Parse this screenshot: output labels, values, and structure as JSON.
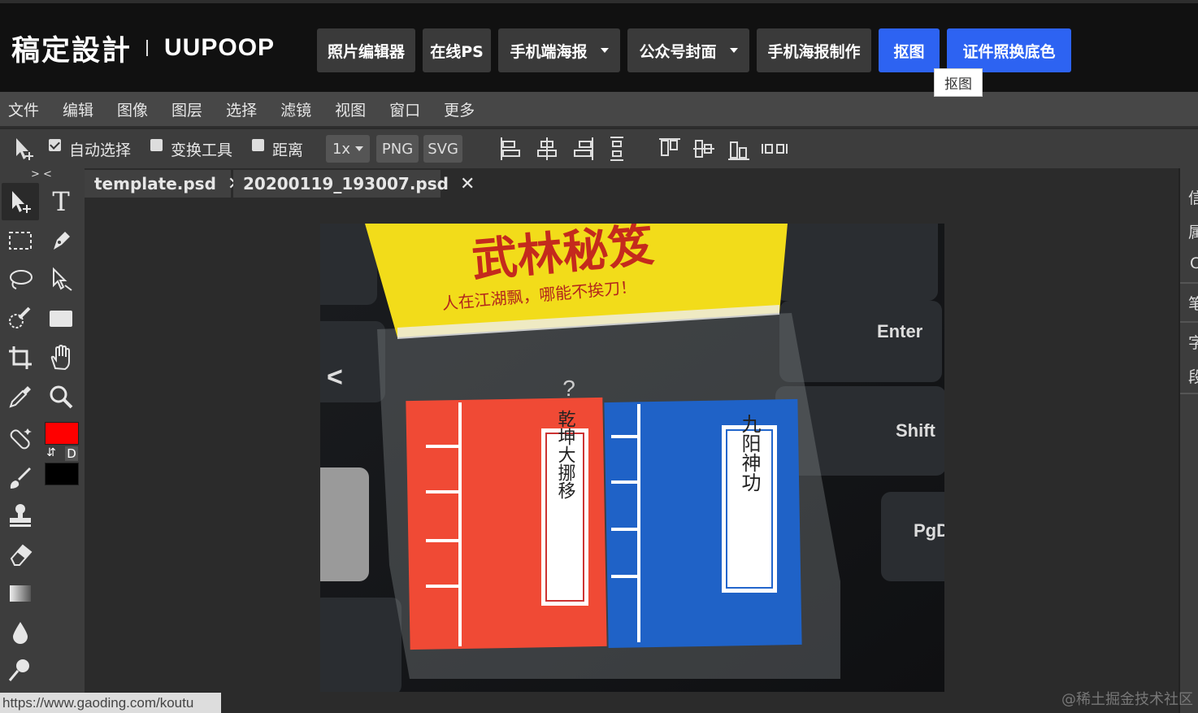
{
  "brand": {
    "logo_text": "稿定設計",
    "site_name": "UUPOOP"
  },
  "nav": {
    "buttons": [
      {
        "label": "照片编辑器"
      },
      {
        "label": "在线PS"
      },
      {
        "label": "手机端海报"
      },
      {
        "label": "公众号封面"
      },
      {
        "label": "手机海报制作"
      },
      {
        "label": "抠图"
      },
      {
        "label": "证件照换底色"
      }
    ],
    "tooltip": "抠图"
  },
  "menu": {
    "items": [
      "文件",
      "编辑",
      "图像",
      "图层",
      "选择",
      "滤镜",
      "视图",
      "窗口",
      "更多"
    ]
  },
  "options": {
    "auto_select": "自动选择",
    "transform_tool": "变换工具",
    "distance": "距离",
    "scale": "1x",
    "png": "PNG",
    "svg": "SVG"
  },
  "toolbar": {
    "collapse_label": "> <",
    "swap_label": "⇵",
    "default_label": "D"
  },
  "colors": {
    "foreground": "#ff0000",
    "background": "#000000",
    "accent": "#2d63f2"
  },
  "tabs": [
    {
      "label": "template.psd",
      "close": "✕"
    },
    {
      "label": "20200119_193007.psd",
      "close": "✕"
    }
  ],
  "photo": {
    "banner_title": "武林秘笈",
    "banner_subtitle": "人在江湖飘，哪能不挨刀！",
    "book_left": "乾坤大挪移",
    "book_right": "九阳神功",
    "key_enter": "Enter",
    "key_shift": "Shift",
    "key_pgdn": "PgDn",
    "question": "?",
    "arrow": "<"
  },
  "right_panel": {
    "chars": [
      "信",
      "属",
      "C",
      "笔",
      "字",
      "段"
    ]
  },
  "status": {
    "url": "https://www.gaoding.com/koutu"
  },
  "watermark": "@稀土掘金技术社区"
}
